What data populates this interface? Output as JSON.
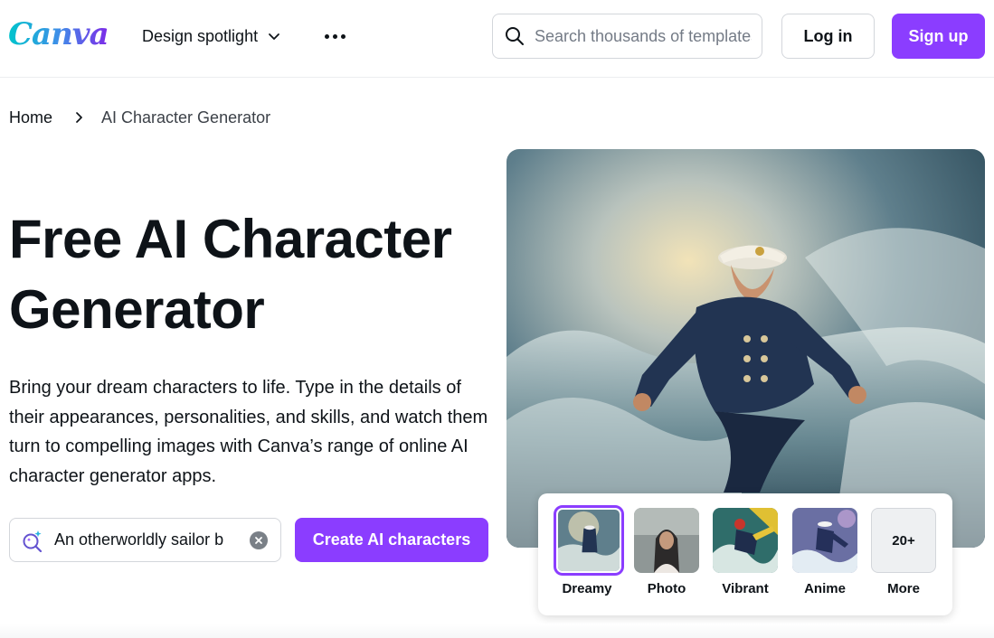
{
  "header": {
    "logo_text": "Canva",
    "nav_label": "Design spotlight",
    "search_placeholder": "Search thousands of templates",
    "login_label": "Log in",
    "signup_label": "Sign up"
  },
  "breadcrumb": {
    "home": "Home",
    "current": "AI Character Generator"
  },
  "hero": {
    "title": "Free AI Character Generator",
    "description": "Bring your dream characters to life. Type in the details of their appearances, personalities, and skills, and watch them turn to compelling images with Canva’s range of online AI character generator apps.",
    "prompt_value": "An otherworldly sailor b",
    "create_label": "Create AI characters"
  },
  "styles": {
    "selected": "Dreamy",
    "items": [
      {
        "label": "Dreamy"
      },
      {
        "label": "Photo"
      },
      {
        "label": "Vibrant"
      },
      {
        "label": "Anime"
      },
      {
        "label": "More",
        "badge": "20+"
      }
    ]
  },
  "colors": {
    "accent": "#8b3dff",
    "text": "#0e1318",
    "border": "#d3d6db"
  },
  "icons": {
    "nav_dropdown": "chevron-down-icon",
    "more": "more-dots-icon",
    "search": "search-icon",
    "breadcrumb_sep": "chevron-right-icon",
    "prompt": "magic-search-icon",
    "clear": "clear-icon"
  }
}
